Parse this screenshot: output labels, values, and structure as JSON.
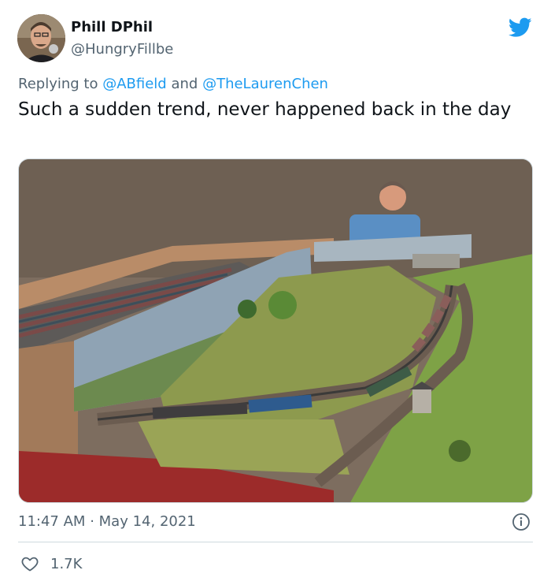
{
  "author": {
    "name": "Phill DPhil",
    "handle": "@HungryFillbe",
    "avatar_icon": "profile-photo-man-with-microphone"
  },
  "reply": {
    "prefix": "Replying to",
    "mention1": "@ABfield",
    "conjunction": "and",
    "mention2": "@TheLaurenChen"
  },
  "tweet": {
    "text": "Such a sudden trend, never happened back in the day",
    "media_description_icon": "model-railway-photo"
  },
  "meta": {
    "time": "11:47 AM",
    "separator": "·",
    "date": "May 14, 2021"
  },
  "engagement": {
    "likes": "1.7K"
  },
  "colors": {
    "accent": "#1d9bf0",
    "secondary_text": "#536471",
    "primary_text": "#0f1419",
    "border": "#cfd9de"
  }
}
